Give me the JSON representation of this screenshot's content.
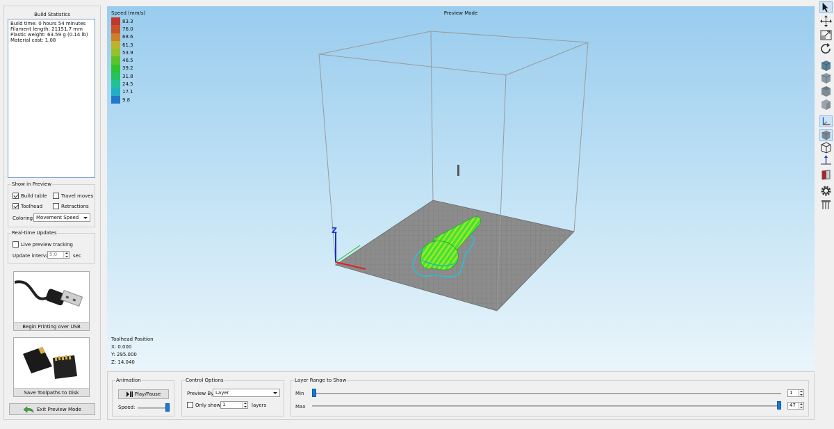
{
  "stats": {
    "title": "Build Statistics",
    "build_time": "Build time: 0 hours 54 minutes",
    "filament_length": "Filament length: 21151.7 mm",
    "plastic_weight": "Plastic weight: 63.59 g (0.14 lb)",
    "material_cost": "Material cost: 1.08"
  },
  "show_in_preview": {
    "title": "Show in Preview",
    "build_table": {
      "label": "Build table",
      "checked": true
    },
    "travel_moves": {
      "label": "Travel moves",
      "checked": false
    },
    "toolhead": {
      "label": "Toolhead",
      "checked": true
    },
    "retractions": {
      "label": "Retractions",
      "checked": false
    },
    "coloring_label": "Coloring",
    "coloring_value": "Movement Speed"
  },
  "realtime": {
    "title": "Real-time Updates",
    "live_tracking": {
      "label": "Live preview tracking",
      "checked": false
    },
    "interval_label": "Update interval",
    "interval_value": "5,0",
    "interval_unit": "sec"
  },
  "buttons": {
    "print_usb": "Begin Printing over USB",
    "save_disk": "Save Toolpaths to Disk",
    "exit_preview": "Exit Preview Mode"
  },
  "viewport": {
    "title": "Preview Mode",
    "legend_title": "Speed (mm/s)",
    "legend": [
      {
        "value": "83.3",
        "color": "#c0392b"
      },
      {
        "value": "76.0",
        "color": "#c8522a"
      },
      {
        "value": "68.6",
        "color": "#cf7f2a"
      },
      {
        "value": "61.3",
        "color": "#bfb32a"
      },
      {
        "value": "53.9",
        "color": "#93c22a"
      },
      {
        "value": "46.5",
        "color": "#5cc22a"
      },
      {
        "value": "39.2",
        "color": "#2fc22f"
      },
      {
        "value": "31.8",
        "color": "#24c25e"
      },
      {
        "value": "24.5",
        "color": "#22c195"
      },
      {
        "value": "17.1",
        "color": "#22aec6"
      },
      {
        "value": "9.8",
        "color": "#2379c8"
      }
    ],
    "toolhead_title": "Toolhead Position",
    "toolhead_x": "X: 0.000",
    "toolhead_y": "Y: 295.000",
    "toolhead_z": "Z: 14.040",
    "axis_z_label": "Z"
  },
  "animation": {
    "title": "Animation",
    "play_label": "Play/Pause",
    "speed_label": "Speed:",
    "speed_level": 1.0
  },
  "control": {
    "title": "Control Options",
    "preview_by_label": "Preview By",
    "preview_by_value": "Layer",
    "only_show": {
      "label": "Only show",
      "checked": false
    },
    "only_show_value": "1",
    "layers_label": "layers"
  },
  "layer_range": {
    "title": "Layer Range to Show",
    "min_label": "Min",
    "max_label": "Max",
    "min_value": "1",
    "max_value": "47",
    "min_level": 0.0,
    "max_level": 1.0
  },
  "toolbar": [
    {
      "name": "select-tool-icon",
      "active": true
    },
    {
      "name": "move-tool-icon",
      "active": false
    },
    {
      "name": "scale-tool-icon",
      "active": false
    },
    {
      "name": "rotate-tool-icon",
      "active": false
    },
    {
      "name": "view-iso-icon",
      "active": false
    },
    {
      "name": "view-front-icon",
      "active": false
    },
    {
      "name": "view-top-icon",
      "active": false
    },
    {
      "name": "view-side-icon",
      "active": false
    },
    {
      "name": "show-axes-icon",
      "active": true
    },
    {
      "name": "show-solid-icon",
      "active": true
    },
    {
      "name": "show-wireframe-icon",
      "active": false
    },
    {
      "name": "show-normals-icon",
      "active": false
    },
    {
      "name": "section-view-icon",
      "active": false
    },
    {
      "name": "settings-gear-icon",
      "active": false
    },
    {
      "name": "support-icon",
      "active": false
    }
  ]
}
